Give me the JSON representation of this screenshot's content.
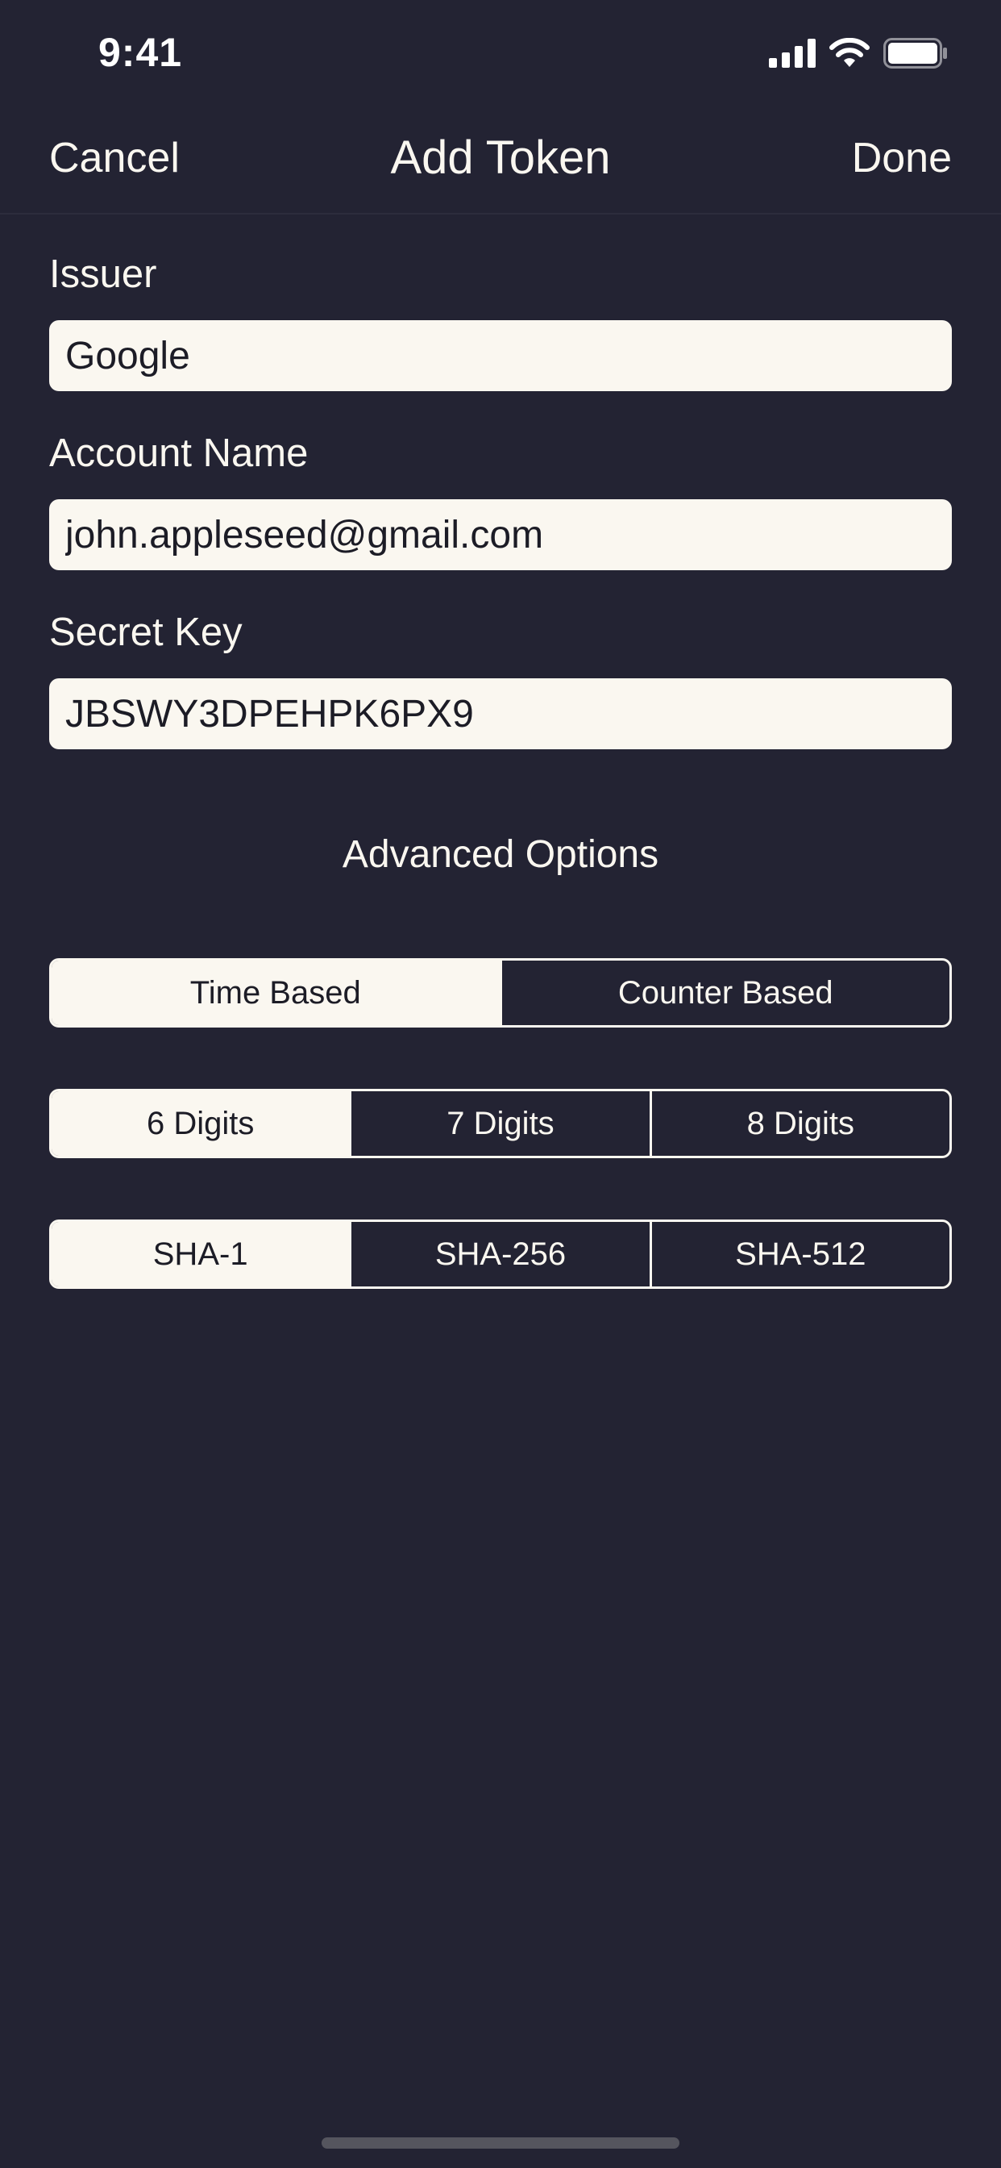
{
  "status_bar": {
    "time": "9:41",
    "icons": [
      "cellular-signal-icon",
      "wifi-icon",
      "battery-icon"
    ]
  },
  "nav": {
    "cancel_label": "Cancel",
    "title": "Add Token",
    "done_label": "Done"
  },
  "form": {
    "issuer": {
      "label": "Issuer",
      "value": "Google"
    },
    "account": {
      "label": "Account Name",
      "value": "john.appleseed@gmail.com"
    },
    "secret": {
      "label": "Secret Key",
      "value": "JBSWY3DPEHPK6PX9"
    }
  },
  "advanced": {
    "title": "Advanced Options",
    "token_type": {
      "options": [
        "Time Based",
        "Counter Based"
      ],
      "selected": "Time Based"
    },
    "digits": {
      "options": [
        "6 Digits",
        "7 Digits",
        "8 Digits"
      ],
      "selected": "6 Digits"
    },
    "algorithm": {
      "options": [
        "SHA-1",
        "SHA-256",
        "SHA-512"
      ],
      "selected": "SHA-1"
    }
  },
  "colors": {
    "background": "#232333",
    "foreground": "#FAF7F0",
    "input_text": "#1C1C26"
  }
}
